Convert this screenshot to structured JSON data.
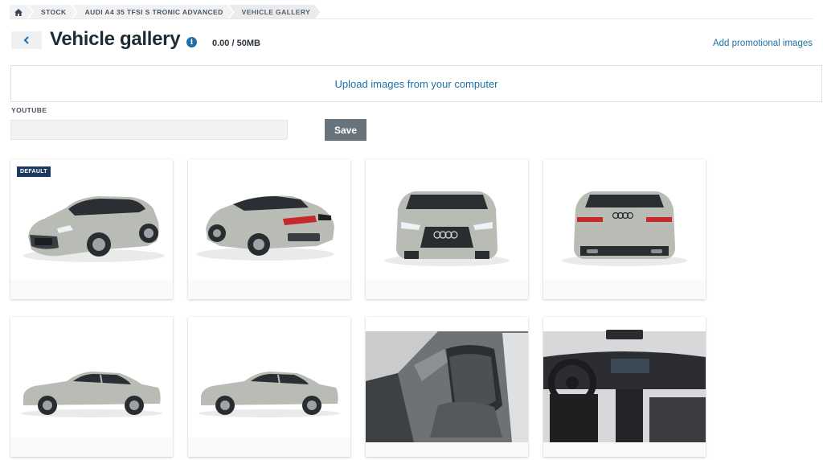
{
  "breadcrumb": {
    "items": [
      {
        "label": "STOCK"
      },
      {
        "label": "AUDI A4 35 TFSI S TRONIC ADVANCED"
      },
      {
        "label": "VEHICLE GALLERY"
      }
    ]
  },
  "header": {
    "title": "Vehicle gallery",
    "storage": "0.00 / 50MB",
    "promo_link": "Add promotional images"
  },
  "upload": {
    "label": "Upload images from your computer"
  },
  "youtube": {
    "label": "YOUTUBE",
    "value": "",
    "placeholder": ""
  },
  "save_label": "Save",
  "gallery": {
    "default_badge": "DEFAULT",
    "images": [
      {
        "view": "front-three-quarter"
      },
      {
        "view": "rear-three-quarter"
      },
      {
        "view": "front"
      },
      {
        "view": "rear"
      },
      {
        "view": "side-left"
      },
      {
        "view": "side-left"
      },
      {
        "view": "interior-front-seats"
      },
      {
        "view": "interior-dashboard"
      }
    ]
  },
  "colors": {
    "accent": "#1d6fa8",
    "badge": "#1b3a5e",
    "save_button": "#69737b",
    "car_body": "#b9bcb5"
  },
  "icons": {
    "home": "home-icon",
    "back": "chevron-left-icon",
    "info": "info-icon"
  }
}
